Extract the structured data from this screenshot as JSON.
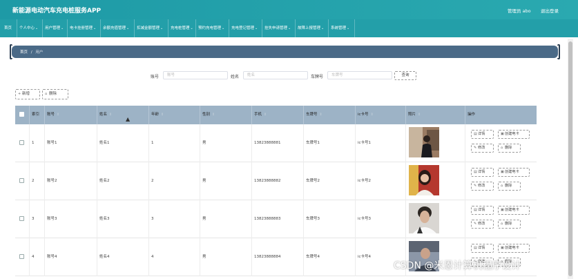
{
  "header": {
    "app_title": "新能源电动汽车充电桩服务APP",
    "admin_text": "管理员 abo",
    "logout": "退出登录"
  },
  "nav": [
    {
      "label": "首页",
      "chev": ""
    },
    {
      "label": "个人中心",
      "chev": "⌄"
    },
    {
      "label": "用户管理",
      "chev": "⌄"
    },
    {
      "label": "电卡挂册管理",
      "chev": "⌄"
    },
    {
      "label": "余额充值管理",
      "chev": "⌄"
    },
    {
      "label": "扣减金额管理",
      "chev": "⌄"
    },
    {
      "label": "充电桩管理",
      "chev": "⌄"
    },
    {
      "label": "预约充电管理",
      "chev": "⌄"
    },
    {
      "label": "充电登记管理",
      "chev": "⌄"
    },
    {
      "label": "挂失申请管理",
      "chev": "⌄"
    },
    {
      "label": "故障上报管理",
      "chev": "⌄"
    },
    {
      "label": "系统管理",
      "chev": "⌄"
    }
  ],
  "breadcrumb": {
    "home": "首页",
    "sep": "/",
    "current": "用户"
  },
  "search": {
    "account_label": "账号",
    "account_placeholder": "账号",
    "name_label": "姓名",
    "name_placeholder": "姓名",
    "plate_label": "车牌号",
    "plate_placeholder": "车牌号",
    "button": "查询"
  },
  "actions": {
    "add": "新增",
    "delete": "删除"
  },
  "icons": {
    "add": "plus-icon",
    "delete": "trash-icon",
    "sort": "sort-icon",
    "detail": "document-icon",
    "card": "card-icon",
    "edit": "pencil-icon",
    "remove": "trash-icon"
  },
  "table": {
    "columns": [
      "",
      "索引",
      "账号",
      "姓名",
      "年龄",
      "性别",
      "手机",
      "车牌号",
      "ic卡号",
      "照片",
      "操作"
    ],
    "sort_glyph": "⇕",
    "ops": {
      "detail": "详情",
      "card": "创建电卡",
      "edit": "修改",
      "delete": "删除"
    },
    "rows": [
      {
        "index": "1",
        "account": "账号1",
        "name": "姓名1",
        "age": "1",
        "gender": "男",
        "phone": "13823888881",
        "plate": "车牌号1",
        "ic": "ic卡号1"
      },
      {
        "index": "2",
        "account": "账号2",
        "name": "姓名2",
        "age": "2",
        "gender": "男",
        "phone": "13823888882",
        "plate": "车牌号2",
        "ic": "ic卡号2"
      },
      {
        "index": "3",
        "account": "账号3",
        "name": "姓名3",
        "age": "3",
        "gender": "男",
        "phone": "13823888883",
        "plate": "车牌号3",
        "ic": "ic卡号3"
      },
      {
        "index": "4",
        "account": "账号4",
        "name": "姓名4",
        "age": "4",
        "gender": "男",
        "phone": "13823888884",
        "plate": "车牌号4",
        "ic": "ic卡号4"
      }
    ]
  },
  "watermark": "CSDN @米恩计算机程序设计",
  "colors": {
    "header": "#1e9aa6",
    "nav": "#239fa9",
    "breadcrumb": "#4a6a87",
    "table_head": "#9db3c6"
  }
}
